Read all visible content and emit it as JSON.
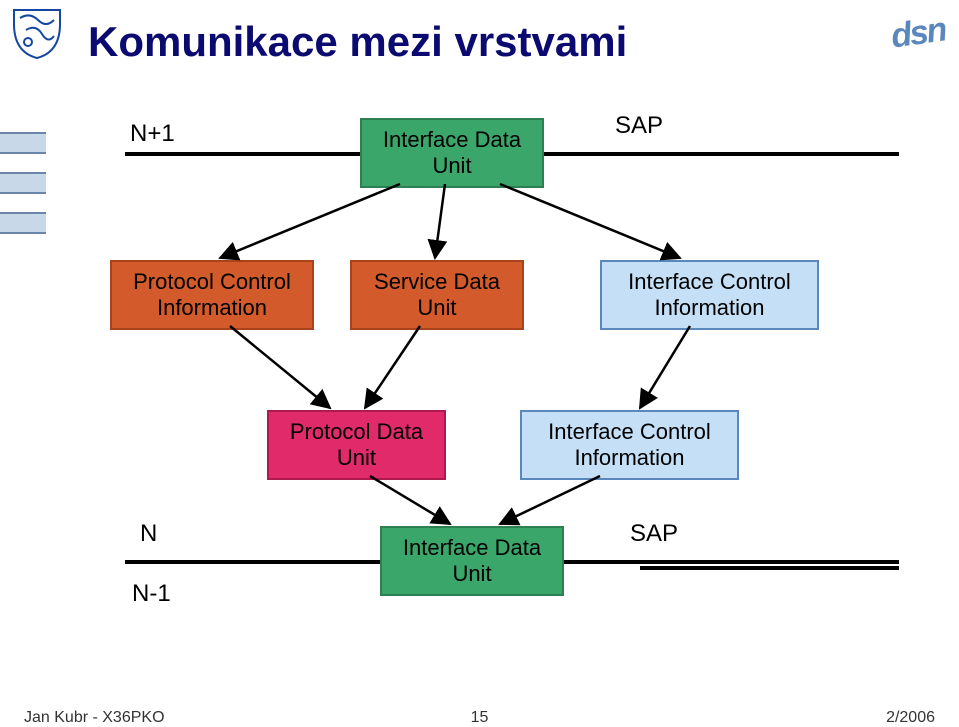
{
  "slide": {
    "title": "Komunikace mezi vrstvami",
    "logo_text": "dsn",
    "footer_left": "Jan Kubr - X36PKO",
    "footer_center": "15",
    "footer_right": "2/2006"
  },
  "labels": {
    "n_plus_1": "N+1",
    "n": "N",
    "n_minus_1": "N-1",
    "sap_top": "SAP",
    "sap_bottom": "SAP"
  },
  "boxes": {
    "idu_top": "Interface Data\nUnit",
    "pci": "Protocol Control\nInformation",
    "sdu": "Service Data\nUnit",
    "ici_top": "Interface Control\nInformation",
    "pdu": "Protocol Data\nUnit",
    "ici_bottom": "Interface Control\nInformation",
    "idu_bottom": "Interface Data\nUnit"
  },
  "chart_data": {
    "type": "other",
    "title": "Komunikace mezi vrstvami",
    "description": "Block diagram of layered communication between OSI/network layers N+1, N, N-1 showing how an Interface Data Unit is decomposed and reassembled.",
    "layers": [
      "N+1",
      "N",
      "N-1"
    ],
    "nodes": [
      {
        "id": "idu_top",
        "label": "Interface Data Unit",
        "layer": "N+1",
        "color": "green"
      },
      {
        "id": "sap_top",
        "label": "SAP",
        "layer": "N+1"
      },
      {
        "id": "pci",
        "label": "Protocol Control Information",
        "layer": "N",
        "color": "orange"
      },
      {
        "id": "sdu",
        "label": "Service Data Unit",
        "layer": "N",
        "color": "orange"
      },
      {
        "id": "ici_top",
        "label": "Interface Control Information",
        "layer": "N",
        "color": "blue"
      },
      {
        "id": "pdu",
        "label": "Protocol Data Unit",
        "layer": "N",
        "color": "pink"
      },
      {
        "id": "ici_bottom",
        "label": "Interface Control Information",
        "layer": "N",
        "color": "blue"
      },
      {
        "id": "idu_bottom",
        "label": "Interface Data Unit",
        "layer": "N-1",
        "color": "green"
      },
      {
        "id": "sap_bottom",
        "label": "SAP",
        "layer": "N-1"
      }
    ],
    "edges": [
      {
        "from": "idu_top",
        "to": "pci"
      },
      {
        "from": "idu_top",
        "to": "sdu"
      },
      {
        "from": "idu_top",
        "to": "ici_top"
      },
      {
        "from": "pci",
        "to": "pdu"
      },
      {
        "from": "sdu",
        "to": "pdu"
      },
      {
        "from": "ici_top",
        "to": "ici_bottom"
      },
      {
        "from": "pdu",
        "to": "idu_bottom"
      },
      {
        "from": "ici_bottom",
        "to": "idu_bottom"
      }
    ]
  }
}
